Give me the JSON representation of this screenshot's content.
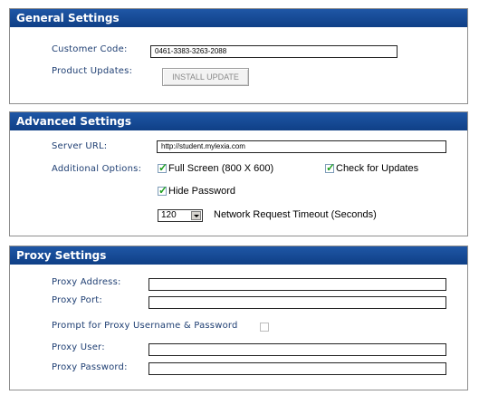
{
  "general": {
    "title": "General Settings",
    "customer_code_label": "Customer Code:",
    "customer_code_value": "0461-3383-3263-2088",
    "product_updates_label": "Product Updates:",
    "install_update_label": "INSTALL UPDATE"
  },
  "advanced": {
    "title": "Advanced Settings",
    "server_url_label": "Server URL:",
    "server_url_value": "http://student.mylexia.com",
    "additional_options_label": "Additional Options:",
    "full_screen_label": "Full Screen (800 X 600)",
    "full_screen_checked": true,
    "check_updates_label": "Check for Updates",
    "check_updates_checked": true,
    "hide_password_label": "Hide Password",
    "hide_password_checked": true,
    "timeout_value": "120",
    "timeout_label": "Network Request Timeout (Seconds)"
  },
  "proxy": {
    "title": "Proxy Settings",
    "address_label": "Proxy Address:",
    "port_label": "Proxy Port:",
    "prompt_label": "Prompt for Proxy Username & Password",
    "prompt_checked": false,
    "user_label": "Proxy User:",
    "password_label": "Proxy Password:"
  }
}
